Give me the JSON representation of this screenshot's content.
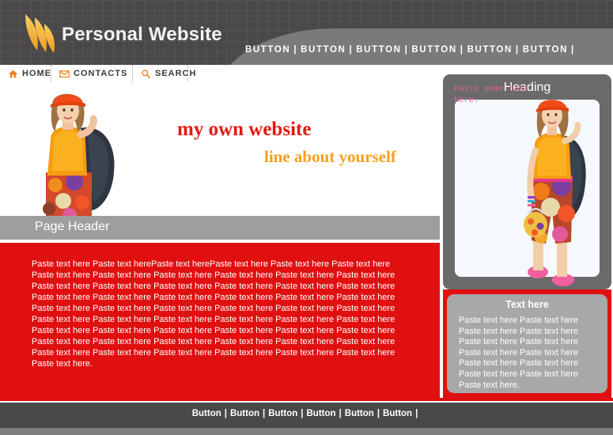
{
  "header": {
    "brand": "Personal Website",
    "logo_icon": "flames-logo-icon",
    "logo_colors": [
      "#f5c14b",
      "#f0a62e"
    ],
    "top_buttons": [
      {
        "label": "BUTTON"
      },
      {
        "label": "BUTTON"
      },
      {
        "label": "BUTTON"
      },
      {
        "label": "BUTTON"
      },
      {
        "label": "BUTTON"
      },
      {
        "label": "BUTTON"
      }
    ],
    "separator": "|"
  },
  "tabs": [
    {
      "label": "HOME",
      "icon": "home-icon"
    },
    {
      "label": "CONTACTS",
      "icon": "envelope-icon"
    },
    {
      "label": "SEARCH",
      "icon": "magnifier-icon"
    }
  ],
  "hero": {
    "line1": "my own website",
    "line2": "line about yourself",
    "line1_color": "#e01b12",
    "line2_color": "#f5a01b",
    "image_alt": "girl-in-orange-top-photo"
  },
  "page_header": {
    "title": "Page Header",
    "bar_color": "#9e9e9e"
  },
  "content": {
    "background_color": "#e01010",
    "body_text": "Paste text here Paste text herePaste text herePaste text here Paste text here Paste text here Paste text here Paste text here Paste text here Paste text here Paste text here Paste text here Paste text here Paste text here Paste text here Paste text here Paste text here Paste text here Paste text here Paste text here Paste text here Paste text here Paste text here Paste text here  Paste text here Paste text here Paste text here Paste text here Paste text here Paste text here Paste text here Paste text here Paste text here Paste text here Paste text here Paste text here Paste text here Paste text here Paste text here Paste text here Paste text here Paste text here Paste text here Paste text here Paste text here Paste text here Paste text here Paste text here Paste text here Paste text here Paste text here Paste text here Paste text here Paste text here Paste text here."
  },
  "sidebar": {
    "heading": "Heading",
    "panel_color": "#6b6a6a",
    "inner_text": "Paste some text here.",
    "inner_text_color": "#e0609a",
    "inner_box_color": "#f5f9fd",
    "image_alt": "girl-full-body-photo",
    "box2_heading": "Text here",
    "box2_color": "#a8a8a8",
    "box2_text": "Paste text here Paste text here Paste text here Paste text here Paste text here Paste text here Paste text here Paste text here Paste text here Paste text here Paste text here Paste text here Paste text here."
  },
  "footer": {
    "buttons": [
      {
        "label": "Button"
      },
      {
        "label": "Button"
      },
      {
        "label": "Button"
      },
      {
        "label": "Button"
      },
      {
        "label": "Button"
      },
      {
        "label": "Button"
      }
    ],
    "separator": "|",
    "background_color": "#4a4848",
    "accent_color": "#e01010"
  }
}
